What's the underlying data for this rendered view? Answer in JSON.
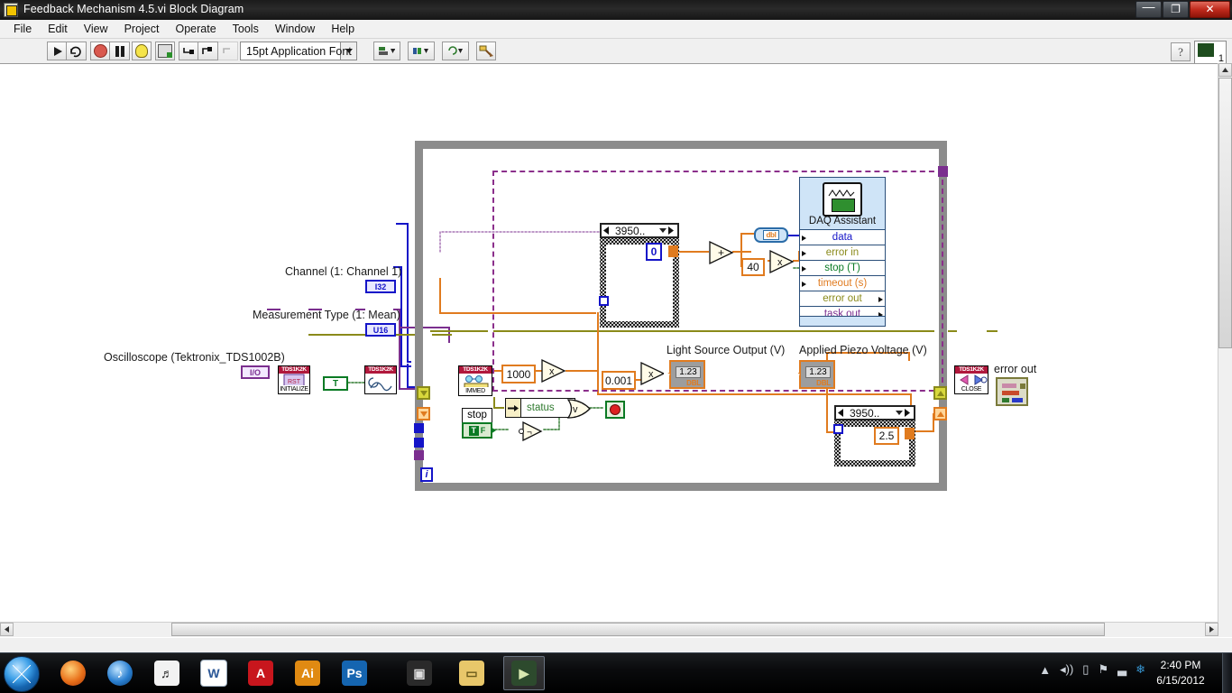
{
  "window": {
    "title": "Feedback Mechanism 4.5.vi Block Diagram",
    "icon_name": "labview-vi-icon",
    "minimize_label": "—",
    "maximize_label": "❐",
    "close_label": "✕"
  },
  "menu": {
    "items": [
      "File",
      "Edit",
      "View",
      "Project",
      "Operate",
      "Tools",
      "Window",
      "Help"
    ]
  },
  "toolbar": {
    "run_title": "Run",
    "run_continuous_title": "Run Continuously",
    "abort_title": "Abort Execution",
    "pause_title": "Pause",
    "highlight_title": "Highlight Execution",
    "retain_title": "Retain Wire Values",
    "step_into_title": "Step Into",
    "step_over_title": "Step Over",
    "step_out_title": "Step Out",
    "font_selector_value": "15pt Application Font",
    "align_title": "Align Objects",
    "distribute_title": "Distribute Objects",
    "reorder_title": "Reorder",
    "cleanup_title": "Clean Up Diagram",
    "context_help_label": "?",
    "lv_badge_count": "1"
  },
  "diagram": {
    "labels": {
      "channel": "Channel (1: Channel 1)",
      "measurement_type": "Measurement Type (1: Mean)",
      "oscilloscope": "Oscilloscope (Tektronix_TDS1002B)",
      "light_source_output": "Light Source Output (V)",
      "applied_piezo_voltage": "Applied Piezo Voltage (V)",
      "error_out": "error out"
    },
    "terminals": {
      "channel_type": "I32",
      "measurement_type": "U16",
      "resource_type": "I/O"
    },
    "vis": {
      "initialize_header": "TDS1K2K",
      "initialize_footer": "INITIALIZE",
      "autoset_header": "TDS1K2K",
      "immediate_header": "TDS1K2K",
      "immediate_footer": "IMMED",
      "close_header": "TDS1K2K",
      "close_footer": "CLOSE"
    },
    "daq_assistant": {
      "name": "DAQ Assistant",
      "terminals": [
        {
          "label": "data",
          "color": "#1414c8",
          "dir": "in"
        },
        {
          "label": "error in",
          "color": "#8a8a1a",
          "dir": "in"
        },
        {
          "label": "stop (T)",
          "color": "#0a7a24",
          "dir": "in"
        },
        {
          "label": "timeout (s)",
          "color": "#e07b1f",
          "dir": "in"
        },
        {
          "label": "error out",
          "color": "#8a8a1a",
          "dir": "out"
        },
        {
          "label": "task out",
          "color": "#7b2f8f",
          "dir": "out"
        }
      ]
    },
    "case_structures": [
      {
        "name": "upper-case-structure",
        "selector": "3950..",
        "constant": "0"
      },
      {
        "name": "lower-case-structure",
        "selector": "3950..",
        "constant": "2.5"
      }
    ],
    "constants": {
      "gain_1000": "1000",
      "scale_0001": "0.001",
      "offset_40": "40",
      "boolean_true": "T",
      "zero": "0",
      "two_point_five": "2.5"
    },
    "functions": {
      "add": "+",
      "multiply": "x",
      "or": "v",
      "not": "¬",
      "to_dbl": "dbl"
    },
    "indicators": {
      "light_source_value": "1.23",
      "piezo_value": "1.23",
      "representation": "DBL"
    },
    "controls": {
      "stop_label": "stop",
      "stop_bool": "TF",
      "status_label": "status",
      "iteration_label": "i"
    }
  },
  "taskbar": {
    "start_name": "start-orb",
    "apps": [
      {
        "name": "firefox",
        "label": "●",
        "color": "#e8701a"
      },
      {
        "name": "itunes",
        "label": "♪",
        "color": "#2a7fd0"
      },
      {
        "name": "guitar-pro",
        "label": "♩",
        "color": "#e9e9e9"
      },
      {
        "name": "microsoft-word",
        "label": "W",
        "color": "#2b5797"
      },
      {
        "name": "adobe-acrobat",
        "label": "A",
        "color": "#c8161d"
      },
      {
        "name": "adobe-illustrator",
        "label": "Ai",
        "color": "#e08a12"
      },
      {
        "name": "adobe-photoshop",
        "label": "Ps",
        "color": "#1565b0"
      },
      {
        "name": "video-player",
        "label": "▣",
        "color": "#3a3a3a"
      },
      {
        "name": "windows-explorer",
        "label": "▭",
        "color": "#e8c76a"
      },
      {
        "name": "labview",
        "label": "▶",
        "color": "#3a5a3a"
      }
    ],
    "tray": [
      "▲",
      "◂))",
      "▯",
      "⚑",
      "▃",
      "❄"
    ],
    "clock_time": "2:40 PM",
    "clock_date": "6/15/2012"
  }
}
